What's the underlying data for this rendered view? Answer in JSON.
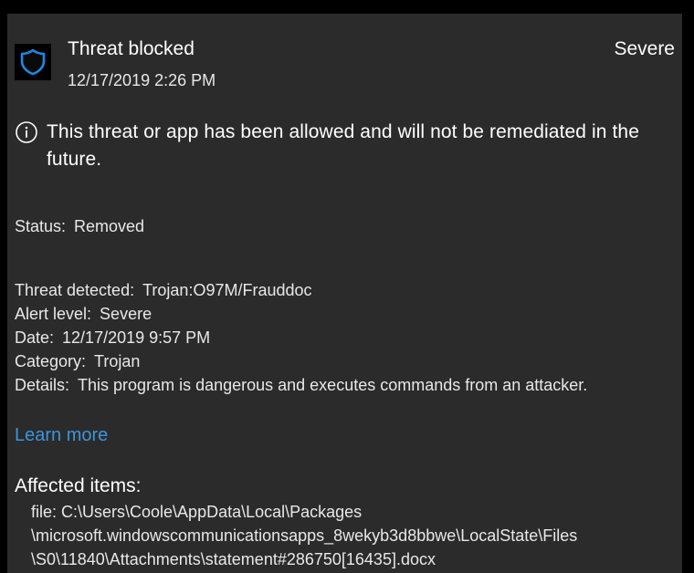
{
  "header": {
    "icon": "shield-icon",
    "title": "Threat blocked",
    "severity": "Severe",
    "timestamp": "12/17/2019 2:26 PM"
  },
  "notice": {
    "icon": "info-icon",
    "text": "This threat or app has been allowed and will not be remediated in the future."
  },
  "status": {
    "label": "Status:",
    "value": "Removed"
  },
  "details": [
    {
      "label": "Threat detected:",
      "value": "Trojan:O97M/Frauddoc"
    },
    {
      "label": "Alert level:",
      "value": "Severe"
    },
    {
      "label": "Date:",
      "value": "12/17/2019 9:57 PM"
    },
    {
      "label": "Category:",
      "value": "Trojan"
    },
    {
      "label": "Details:",
      "value": "This program is dangerous and executes commands from an attacker."
    }
  ],
  "learn_more": "Learn more",
  "affected": {
    "title": "Affected items:",
    "lines": [
      "file: C:\\Users\\Coole\\AppData\\Local\\Packages",
      "\\microsoft.windowscommunicationsapps_8wekyb3d8bbwe\\LocalState\\Files",
      "\\S0\\11840\\Attachments\\statement#286750[16435].docx"
    ]
  },
  "colors": {
    "background": "#2b2b2b",
    "link": "#3a96dd",
    "shield_outline": "#1e88e5"
  }
}
